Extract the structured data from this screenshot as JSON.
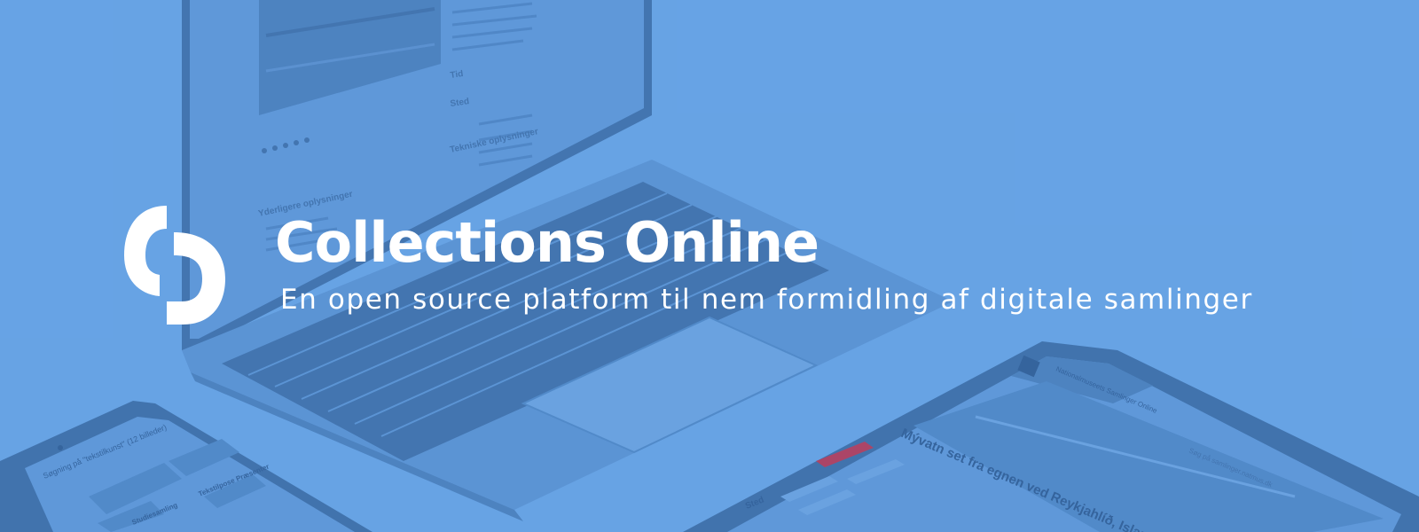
{
  "banner": {
    "title": "Collections Online",
    "subtitle": "En open source platform til nem formidling af digitale samlinger",
    "logo_icon": "collections-online-logo-icon"
  },
  "background": {
    "description_icon": "devices-mockup-image",
    "colors": {
      "base": "#67a3e5",
      "device_dark": "#3d6ea8",
      "device_mid": "#4f87c7",
      "screen": "#5e97d9",
      "text": "#ffffff"
    }
  },
  "laptop_screen": {
    "section_tid": "Tid",
    "section_sted": "Sted",
    "section_tekniske": "Tekniske oplysninger",
    "section_yderligere": "Yderligere oplysninger"
  },
  "tablet_screen": {
    "headline": "Mývatn set fra egnen ved Reykjahlíð, Island",
    "brand": "Nationalmuseets Samlinger Online",
    "search_placeholder": "Søg på samlinger.natmus.dk",
    "section": "Sted"
  },
  "phone_screen": {
    "query": "Søgning på \"tekstilkunst\" (12 billeder)",
    "item_1": "Studiesamling",
    "item_2": "Tekstilpose Præsenter"
  }
}
